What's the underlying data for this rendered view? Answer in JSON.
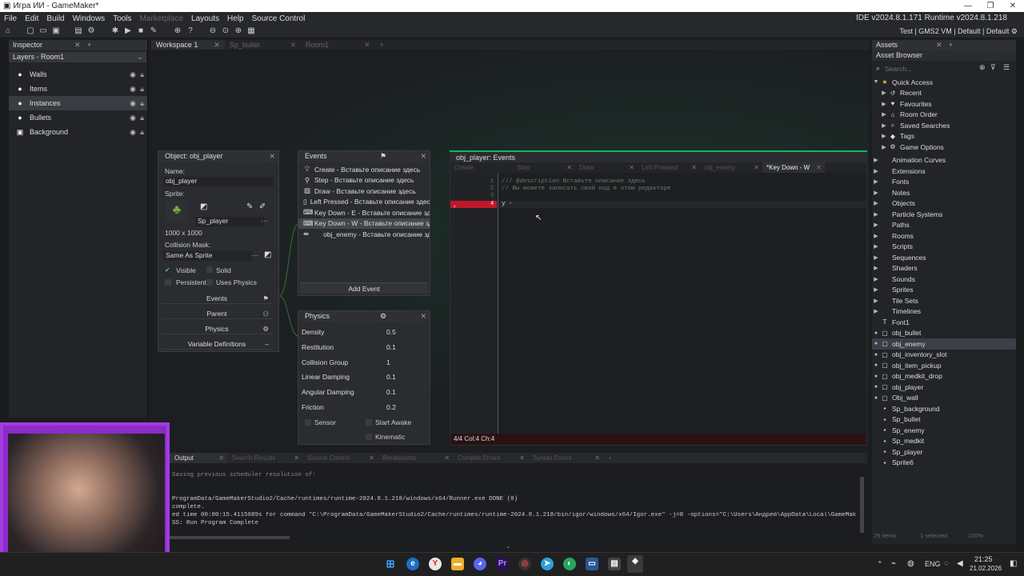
{
  "window": {
    "title": "Игра ИИ - GameMaker*"
  },
  "menu": {
    "items": [
      "File",
      "Edit",
      "Build",
      "Windows",
      "Tools",
      "Marketplace",
      "Layouts",
      "Help",
      "Source Control"
    ],
    "disabled": "Marketplace",
    "ide_version": "IDE v2024.8.1.171  Runtime v2024.8.1.218"
  },
  "target": {
    "text": "Test | GMS2 VM | Default | Default"
  },
  "inspector": {
    "tab": "Inspector",
    "header": "Layers - Room1",
    "layers": [
      {
        "name": "Walls",
        "icon": "instance-layer-icon"
      },
      {
        "name": "Items",
        "icon": "instance-layer-icon"
      },
      {
        "name": "Instances",
        "icon": "instance-layer-icon",
        "selected": true
      },
      {
        "name": "Bullets",
        "icon": "instance-layer-icon"
      },
      {
        "name": "Background",
        "icon": "background-layer-icon"
      }
    ]
  },
  "workspace": {
    "tabs": [
      {
        "label": "Workspace 1",
        "active": true
      },
      {
        "label": "Sp_bullet"
      },
      {
        "label": "Room1"
      }
    ]
  },
  "object": {
    "title": "Object: obj_player",
    "name_label": "Name:",
    "name": "obj_player",
    "sprite_label": "Sprite:",
    "sprite": "Sp_player",
    "size": "1000 x 1000",
    "mask_label": "Collision Mask:",
    "mask": "Same As Sprite",
    "visible": "Visible",
    "solid": "Solid",
    "persistent": "Persistent",
    "uses_physics": "Uses Physics",
    "buttons": [
      "Events",
      "Parent",
      "Physics",
      "Variable Definitions"
    ]
  },
  "events": {
    "title": "Events",
    "items": [
      "Create - Вставьте описание здесь",
      "Step - Вставьте описание здесь",
      "Draw - Вставьте описание здесь",
      "Left Pressed - Вставьте описание здесь",
      "Key Down - E - Вставьте описание здесь",
      "Key Down - W - Вставьте описание здесь",
      "obj_enemy - Вставьте описание здесь"
    ],
    "selected": 5,
    "add": "Add Event"
  },
  "physics": {
    "title": "Physics",
    "rows": [
      [
        "Density",
        "0.5"
      ],
      [
        "Restitution",
        "0.1"
      ],
      [
        "Collision Group",
        "1"
      ],
      [
        "Linear Damping",
        "0.1"
      ],
      [
        "Angular Damping",
        "0.1"
      ],
      [
        "Friction",
        "0.2"
      ]
    ],
    "sensor": "Sensor",
    "start_awake": "Start Awake",
    "kinematic": "Kinematic"
  },
  "code_editor": {
    "title": "obj_player: Events",
    "tabs": [
      "Create",
      "Step",
      "Draw",
      "Left Pressed",
      "obj_enemy",
      "*Key Down - W"
    ],
    "lines": [
      "/// @description Вставьте описание здесь",
      "// Вы можете записать свой код в этом редакторе",
      "",
      "y -"
    ],
    "status": "4/4 Col:4 Ch:4"
  },
  "output": {
    "tabs": [
      "Output",
      "Search Results",
      "Source Control",
      "Breakpoints",
      "Compile Errors",
      "Syntax Errors"
    ],
    "lines": [
      "Saving previous scheduler resolution of:",
      "",
      "ProgramData/GameMakerStudio2/Cache/runtimes/runtime-2024.8.1.218/windows/x64/Runner.exe DONE (0)",
      "complete.",
      "ed time 00:00:15.4115689s for command \"C:\\ProgramData/GameMakerStudio2/Cache/runtimes/runtime-2024.8.1.218/bin/igor/windows/x64/Igor.exe\" -j=8  -options=\"C:\\Users\\Андрей\\AppData\\Local\\GameMak",
      "SS: Run Program Complete"
    ]
  },
  "assets": {
    "tab": "Assets",
    "browser": "Asset Browser",
    "search_placeholder": "Search...",
    "quick_access": "Quick Access",
    "quick": [
      "Recent",
      "Favourites",
      "Room Order",
      "Saved Searches",
      "Tags",
      "Game Options"
    ],
    "groups": [
      "Animation Curves",
      "Extensions",
      "Fonts",
      "Notes",
      "Objects",
      "Particle Systems",
      "Paths",
      "Rooms",
      "Scripts",
      "Sequences",
      "Shaders",
      "Sounds",
      "Sprites",
      "Tile Sets",
      "Timelines"
    ],
    "items": [
      "Font1",
      "obj_bullet",
      "obj_enemy",
      "obj_inventory_slot",
      "obj_item_pickup",
      "obj_medkit_drop",
      "obj_player",
      "Obj_wall",
      "Sp_background",
      "Sp_bullet",
      "Sp_enemy",
      "Sp_medkit",
      "Sp_player",
      "Sprite6"
    ],
    "selected": "obj_enemy",
    "footer_items": "29 items",
    "footer_sel": "1 selected",
    "zoom": "100%"
  },
  "taskbar": {
    "lang": "ENG",
    "time": "21:25",
    "date": "21.02.2026"
  },
  "colors": {
    "accent": "#00c853",
    "error": "#c0182a",
    "selection": "#3c3e48"
  }
}
